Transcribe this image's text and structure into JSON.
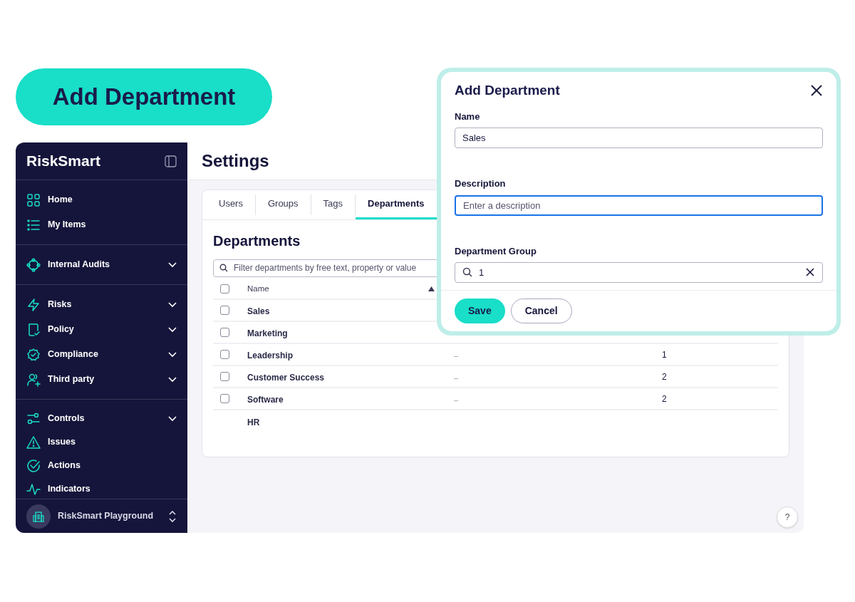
{
  "hero_label": "Add Department",
  "sidebar": {
    "brand": "RiskSmart",
    "groups": [
      {
        "items": [
          {
            "label": "Home",
            "expandable": false
          },
          {
            "label": "My Items",
            "expandable": false
          }
        ]
      },
      {
        "items": [
          {
            "label": "Internal Audits",
            "expandable": true
          }
        ]
      },
      {
        "items": [
          {
            "label": "Risks",
            "expandable": true
          },
          {
            "label": "Policy",
            "expandable": true
          },
          {
            "label": "Compliance",
            "expandable": true
          },
          {
            "label": "Third party",
            "expandable": true
          }
        ]
      },
      {
        "items": [
          {
            "label": "Controls",
            "expandable": true
          },
          {
            "label": "Issues",
            "expandable": false
          },
          {
            "label": "Actions",
            "expandable": false
          },
          {
            "label": "Indicators",
            "expandable": false
          }
        ]
      }
    ],
    "workspace": "RiskSmart Playground"
  },
  "page_title": "Settings",
  "tabs": [
    {
      "label": "Users",
      "selected": false
    },
    {
      "label": "Groups",
      "selected": false
    },
    {
      "label": "Tags",
      "selected": false
    },
    {
      "label": "Departments",
      "selected": true
    }
  ],
  "section_title": "Departments",
  "filter": {
    "placeholder": "Filter departments by free text, property or value"
  },
  "table": {
    "columns": [
      "Name"
    ],
    "select_all": {
      "checked": false
    },
    "rows": [
      {
        "name": "Sales",
        "has_checkbox": true,
        "checked": false
      },
      {
        "name": "Marketing",
        "has_checkbox": true,
        "checked": false
      },
      {
        "name": "Leadership",
        "has_checkbox": true,
        "checked": false,
        "description": "–",
        "count": "1"
      },
      {
        "name": "Customer Success",
        "has_checkbox": true,
        "checked": false,
        "description": "–",
        "count": "2"
      },
      {
        "name": "Software",
        "has_checkbox": true,
        "checked": false,
        "description": "–",
        "count": "2"
      },
      {
        "name": "HR",
        "has_checkbox": false
      }
    ]
  },
  "help_button": "?",
  "dialog": {
    "title": "Add Department",
    "fields": [
      {
        "kind": "text",
        "label": "Name",
        "value": "Sales",
        "focused": false
      },
      {
        "kind": "text",
        "label": "Description",
        "placeholder": "Enter a description",
        "focused": true
      },
      {
        "kind": "search",
        "label": "Department Group",
        "value": "1",
        "focused": false
      }
    ],
    "buttons": [
      {
        "label": "Save",
        "kind": "primary"
      },
      {
        "label": "Cancel",
        "kind": "secondary"
      }
    ]
  }
}
